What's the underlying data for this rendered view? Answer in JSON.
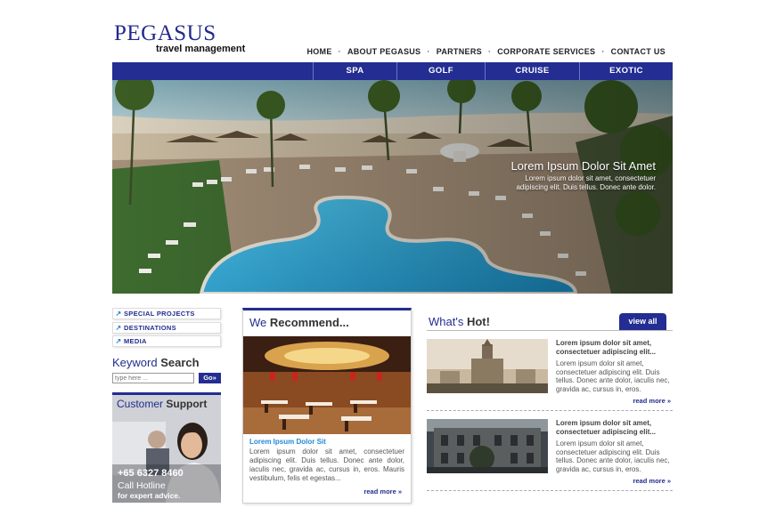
{
  "brand": {
    "name": "PEGASUS",
    "tagline": "travel management"
  },
  "topnav": [
    "HOME",
    "ABOUT PEGASUS",
    "PARTNERS",
    "CORPORATE SERVICES",
    "CONTACT US"
  ],
  "categories": [
    "SPA",
    "GOLF",
    "CRUISE",
    "EXOTIC"
  ],
  "hero": {
    "title": "Lorem Ipsum Dolor Sit Amet",
    "text": "Lorem ipsum dolor sit amet, consectetuer adipiscing elit. Duis tellus. Donec ante dolor."
  },
  "sidebar": {
    "links": [
      "SPECIAL PROJECTS",
      "DESTINATIONS",
      "MEDIA"
    ],
    "search": {
      "title_a": "Keyword",
      "title_b": "Search",
      "placeholder": "type here ...",
      "button": "Go»"
    },
    "support": {
      "title_a": "Customer",
      "title_b": "Support",
      "phone": "+65 6327 8460",
      "call": "Call Hotline",
      "expert": "for expert advice."
    }
  },
  "recommend": {
    "title_a": "We",
    "title_b": "Recommend...",
    "subtitle": "Lorem Ipsum Dolor Sit",
    "text": "Lorem ipsum dolor sit amet, consectetuer adipiscing elit. Duis tellus. Donec ante dolor, iaculis nec, gravida ac, cursus in, eros. Mauris vestibulum, felis et egestas...",
    "more": "read more »"
  },
  "hot": {
    "title_a": "What's",
    "title_b": "Hot!",
    "view_all": "view all",
    "items": [
      {
        "headline": "Lorem ipsum dolor sit amet, consectetuer adipiscing elit...",
        "text": "Lorem ipsum dolor sit amet, consectetuer adipiscing elit. Duis tellus. Donec ante dolor, iaculis nec, gravida ac, cursus in, eros.",
        "more": "read more »"
      },
      {
        "headline": "Lorem ipsum dolor sit amet, consectetuer adipiscing elit...",
        "text": "Lorem ipsum dolor sit amet, consectetuer adipiscing elit. Duis tellus. Donec ante dolor, iaculis nec, gravida ac, cursus in, eros.",
        "more": "read more »"
      }
    ]
  },
  "colors": {
    "brand_blue": "#232d92",
    "link_blue": "#1f8ad6"
  }
}
